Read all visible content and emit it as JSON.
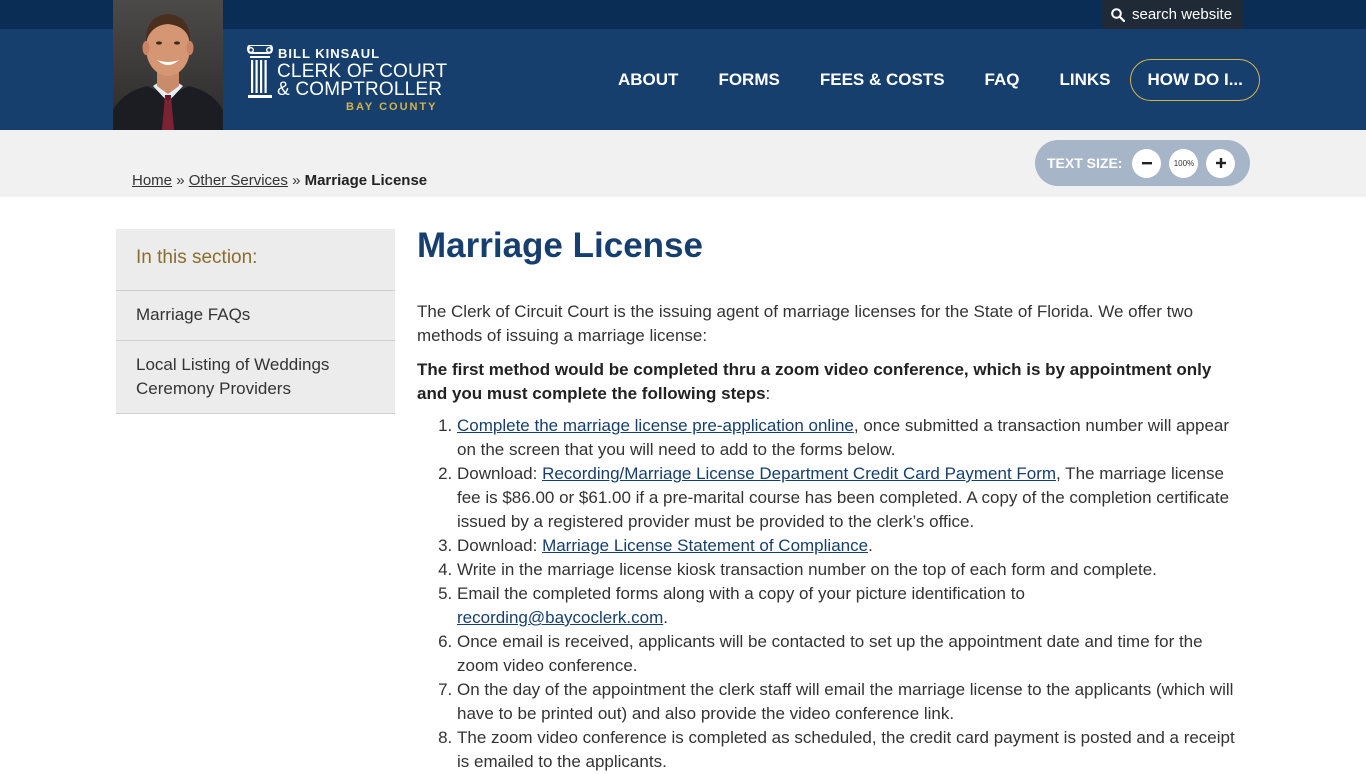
{
  "header": {
    "search_label": "search website",
    "logo": {
      "name": "BILL KINSAUL",
      "line1": "CLERK OF COURT",
      "line2": "& COMPTROLLER",
      "line3": "BAY COUNTY"
    },
    "nav": [
      "ABOUT",
      "FORMS",
      "FEES & COSTS",
      "FAQ",
      "LINKS"
    ],
    "cta": "HOW DO I..."
  },
  "breadcrumb": {
    "home": "Home",
    "sep": "»",
    "parent": "Other Services",
    "current": "Marriage License"
  },
  "text_size": {
    "label": "TEXT SIZE:",
    "value": "100%"
  },
  "sidebar": {
    "heading": "In this section:",
    "items": [
      "Marriage FAQs",
      "Local Listing of Weddings Ceremony Providers"
    ]
  },
  "main": {
    "title": "Marriage License",
    "intro": "The Clerk of Circuit Court is the issuing agent of marriage licenses for the State of Florida. We offer two methods of issuing a marriage license:",
    "lead_bold": "The first method would be completed thru a zoom video conference, which is by appointment only and you must complete the following steps",
    "lead_tail": ":",
    "steps": [
      {
        "link": "Complete the marriage license pre-application online",
        "after": ", once submitted a transaction number will appear on the screen that you will need to add to the forms below."
      },
      {
        "before": "Download: ",
        "link": "Recording/Marriage License Department Credit Card Payment Form",
        "after": ", The marriage license fee is $86.00 or $61.00 if a pre-marital course has been completed. A copy of the completion certificate issued by a registered provider must be provided to the clerk’s office."
      },
      {
        "before": "Download: ",
        "link": "Marriage License Statement of Compliance",
        "after": "."
      },
      {
        "text": "Write in the marriage license kiosk transaction number on the top of each form and complete."
      },
      {
        "before": "Email the completed forms along with a copy of your picture identification to ",
        "link": "recording@baycoclerk.com",
        "after": "."
      },
      {
        "text": "Once email is received, applicants will be contacted to set up the appointment date and time for the zoom video conference."
      },
      {
        "text": "On the day of the appointment the clerk staff will email the marriage license to the applicants (which will have to be printed out) and also provide the video conference link."
      },
      {
        "text": "The zoom video conference is completed as scheduled, the credit card payment is posted and a receipt is emailed to the applicants."
      }
    ]
  },
  "colors": {
    "navy": "#163f6e",
    "topbar": "#0a2d55",
    "gold": "#d6b24a",
    "band": "#f1f1f1",
    "textsize_pill": "#a7b5c8"
  }
}
